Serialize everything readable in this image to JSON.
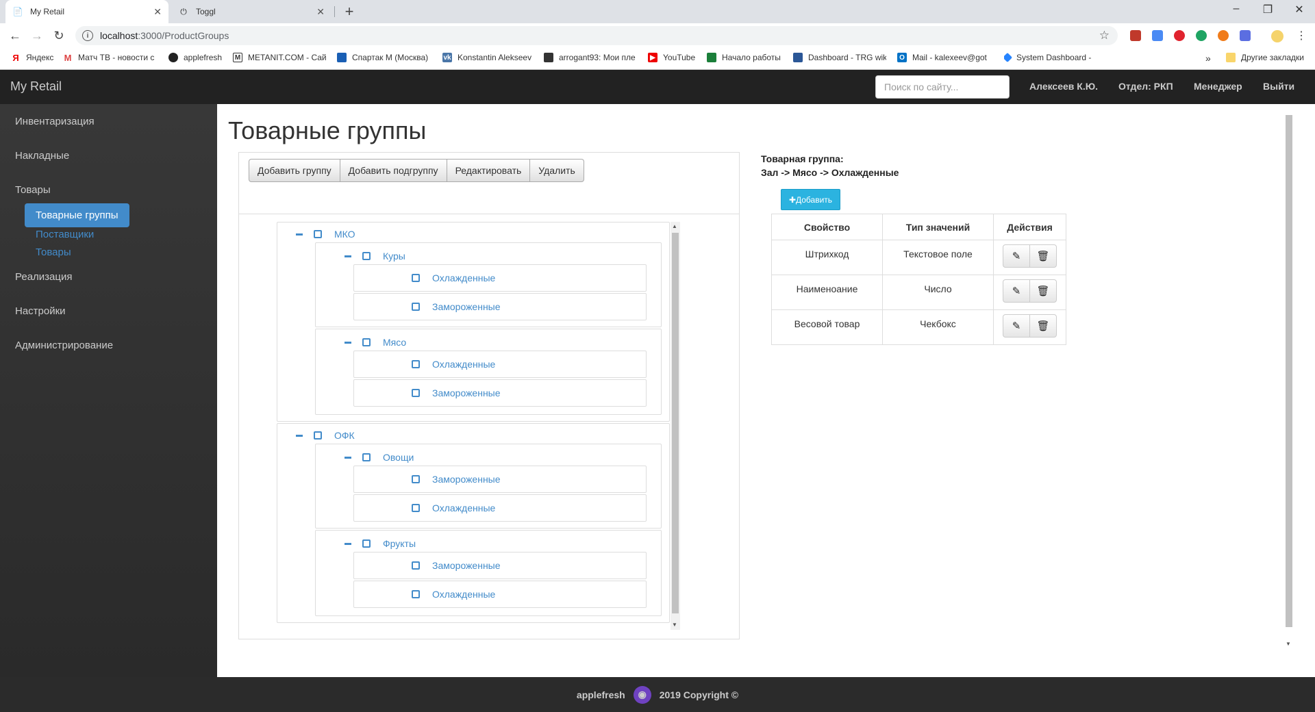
{
  "browser": {
    "tabs": [
      {
        "title": "My Retail",
        "active": true
      },
      {
        "title": "Toggl",
        "active": false
      }
    ],
    "url_host": "localhost",
    "url_path": ":3000/ProductGroups",
    "bookmarks": [
      "Яндекс",
      "Матч ТВ - новости с",
      "applefresh",
      "METANIT.COM - Сай",
      "Спартак М (Москва)",
      "Konstantin Alekseev",
      "arrogant93: Мои пле",
      "YouTube",
      "Начало работы",
      "Dashboard - TRG wik",
      "Mail - kalexeev@got",
      "System Dashboard -"
    ],
    "overflow": "»",
    "other_bookmarks": "Другие закладки"
  },
  "header": {
    "brand": "My Retail",
    "search_placeholder": "Поиск по сайту...",
    "user": "Алексеев К.Ю.",
    "department": "Отдел: РКП",
    "role": "Менеджер",
    "logout": "Выйти"
  },
  "sidebar": {
    "items": [
      "Инвентаризация",
      "Накладные",
      "Товары",
      "Реализация",
      "Настройки",
      "Администрирование"
    ],
    "sub": {
      "active": "Товарные группы",
      "links": [
        "Поставщики",
        "Товары"
      ]
    }
  },
  "page": {
    "title": "Товарные группы",
    "buttons": [
      "Добавить группу",
      "Добавить подгруппу",
      "Редактировать",
      "Удалить"
    ]
  },
  "tree": {
    "g1": {
      "label": "МКО",
      "s1": {
        "label": "Куры",
        "c1": "Охлажденные",
        "c2": "Замороженные"
      },
      "s2": {
        "label": "Мясо",
        "c1": "Охлажденные",
        "c2": "Замороженные"
      }
    },
    "g2": {
      "label": "ОФК",
      "s1": {
        "label": "Овощи",
        "c1": "Замороженные",
        "c2": "Охлажденные"
      },
      "s2": {
        "label": "Фрукты",
        "c1": "Замороженные",
        "c2": "Охлажденные"
      }
    }
  },
  "details": {
    "label": "Товарная группа:",
    "path": "Зал -> Мясо -> Охлажденные",
    "add_button": "Добавить",
    "headers": [
      "Свойство",
      "Тип значений",
      "Действия"
    ],
    "rows": [
      {
        "property": "Штрихкод",
        "type": "Текстовое поле"
      },
      {
        "property": "Наименоание",
        "type": "Число"
      },
      {
        "property": "Весовой товар",
        "type": "Чекбокс"
      }
    ]
  },
  "footer": {
    "author": "applefresh",
    "copyright": "2019 Copyright ©"
  }
}
